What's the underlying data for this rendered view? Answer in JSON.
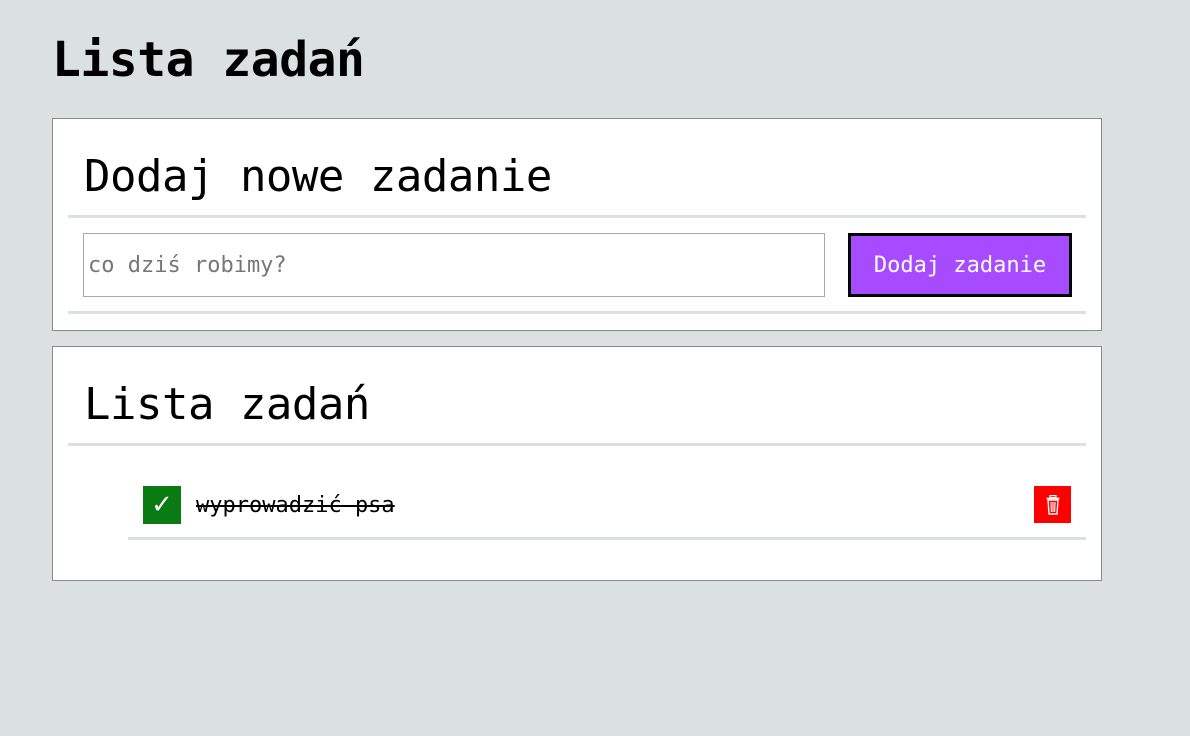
{
  "page": {
    "title": "Lista zadań"
  },
  "add_panel": {
    "heading": "Dodaj nowe zadanie",
    "input_placeholder": "co dziś robimy?",
    "input_value": "",
    "button_label": "Dodaj zadanie"
  },
  "list_panel": {
    "heading": "Lista zadań",
    "tasks": [
      {
        "text": "wyprowadzić psa",
        "done": true,
        "check_glyph": "✓",
        "delete_icon": "trash-icon"
      }
    ]
  },
  "colors": {
    "background": "#dbe0e0",
    "accent": "#a64bff",
    "done": "#0a7a12",
    "delete": "#ff0000"
  }
}
